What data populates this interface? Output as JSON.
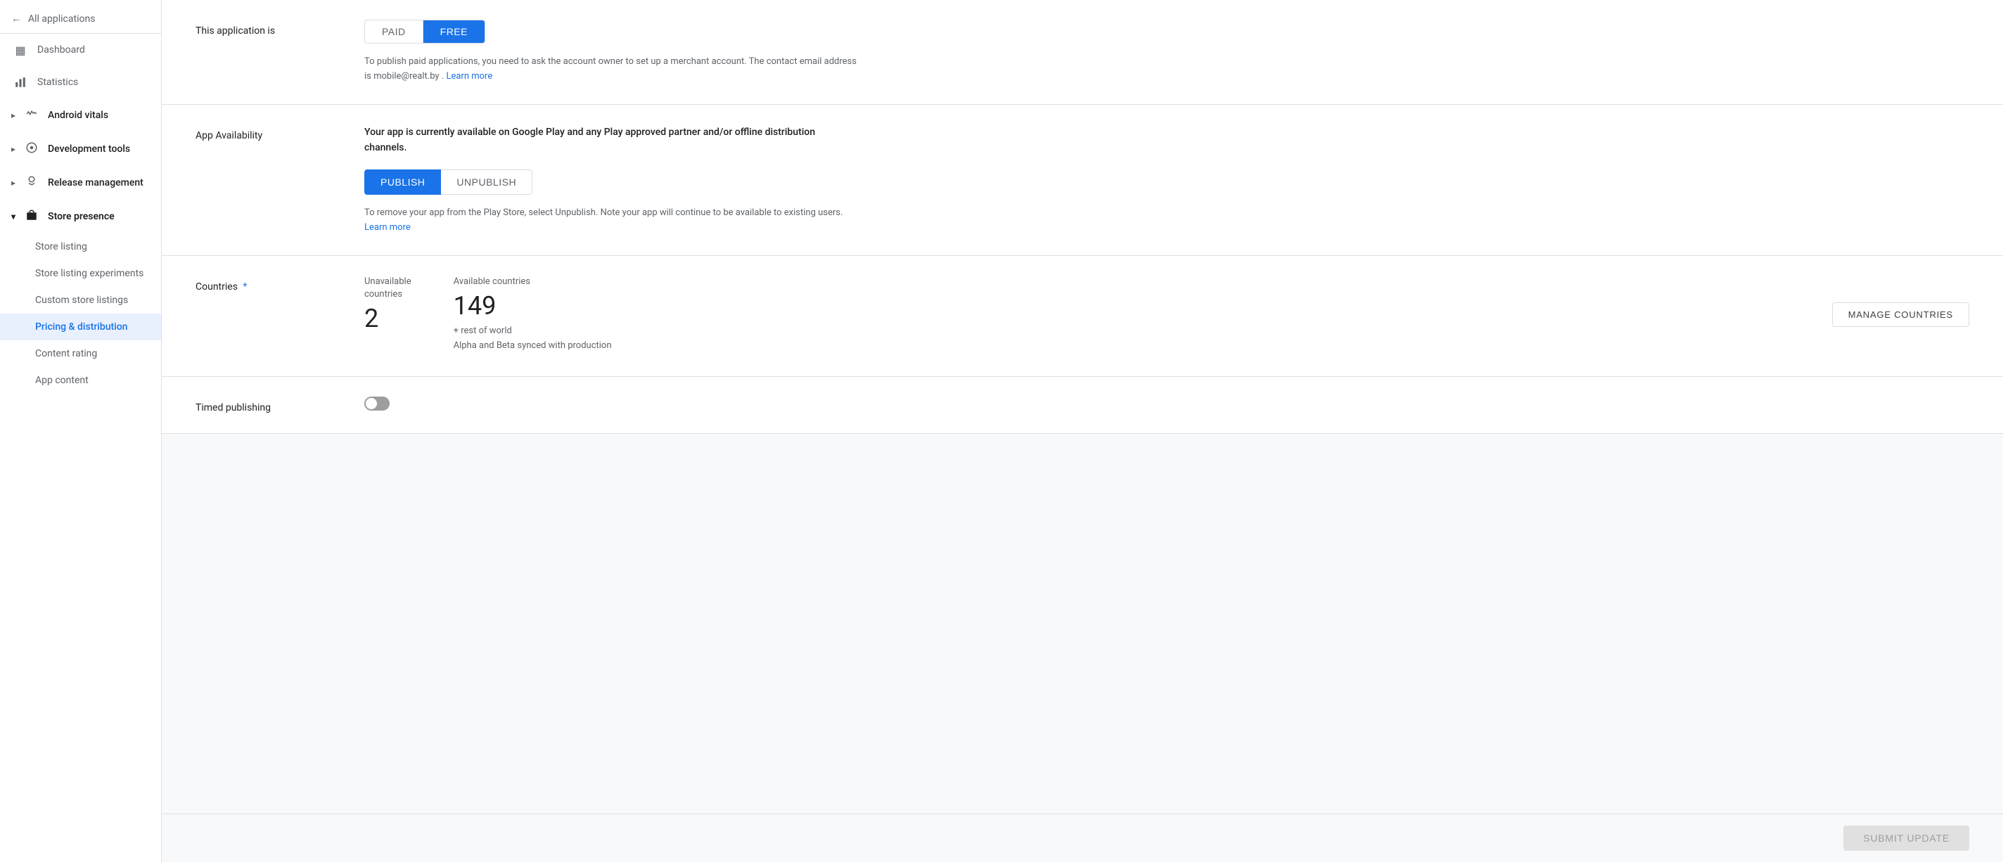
{
  "sidebar": {
    "back_label": "All applications",
    "nav_items": [
      {
        "id": "dashboard",
        "label": "Dashboard",
        "icon": "▦"
      },
      {
        "id": "statistics",
        "label": "Statistics",
        "icon": "▮"
      },
      {
        "id": "android-vitals",
        "label": "Android vitals",
        "icon": "⚡",
        "expandable": true
      },
      {
        "id": "development-tools",
        "label": "Development tools",
        "icon": "⚙",
        "expandable": true
      },
      {
        "id": "release-management",
        "label": "Release management",
        "icon": "🚀",
        "expandable": true
      },
      {
        "id": "store-presence",
        "label": "Store presence",
        "icon": "🛍",
        "expanded": true
      }
    ],
    "store_presence_sub_items": [
      {
        "id": "store-listing",
        "label": "Store listing"
      },
      {
        "id": "store-listing-experiments",
        "label": "Store listing experiments"
      },
      {
        "id": "custom-store-listings",
        "label": "Custom store listings"
      },
      {
        "id": "pricing-distribution",
        "label": "Pricing & distribution",
        "active": true
      },
      {
        "id": "content-rating",
        "label": "Content rating"
      },
      {
        "id": "app-content",
        "label": "App content"
      }
    ]
  },
  "page": {
    "app_is_section": {
      "label": "This application is",
      "paid_label": "PAID",
      "free_label": "FREE",
      "active": "free",
      "info_text": "To publish paid applications, you need to ask the account owner to set up a merchant account. The contact email address is mobile@realt.by .",
      "learn_more_label": "Learn more"
    },
    "availability_section": {
      "label": "App Availability",
      "availability_text": "Your app is currently available on Google Play and any Play approved partner and/or offline distribution channels.",
      "publish_label": "PUBLISH",
      "unpublish_label": "UNPUBLISH",
      "active": "publish",
      "removal_text": "To remove your app from the Play Store, select Unpublish. Note your app will continue to be available to existing users.",
      "removal_learn_more": "Learn more"
    },
    "countries_section": {
      "label": "Countries",
      "required": true,
      "unavailable_label": "Unavailable\ncountries",
      "unavailable_count": "2",
      "available_label": "Available countries",
      "available_count": "149",
      "rest_of_world": "+ rest of world",
      "alpha_beta_text": "Alpha and Beta synced with production",
      "manage_btn_label": "MANAGE COUNTRIES"
    },
    "timed_section": {
      "label": "Timed publishing",
      "enabled": false
    },
    "submit_btn_label": "SUBMIT UPDATE"
  }
}
